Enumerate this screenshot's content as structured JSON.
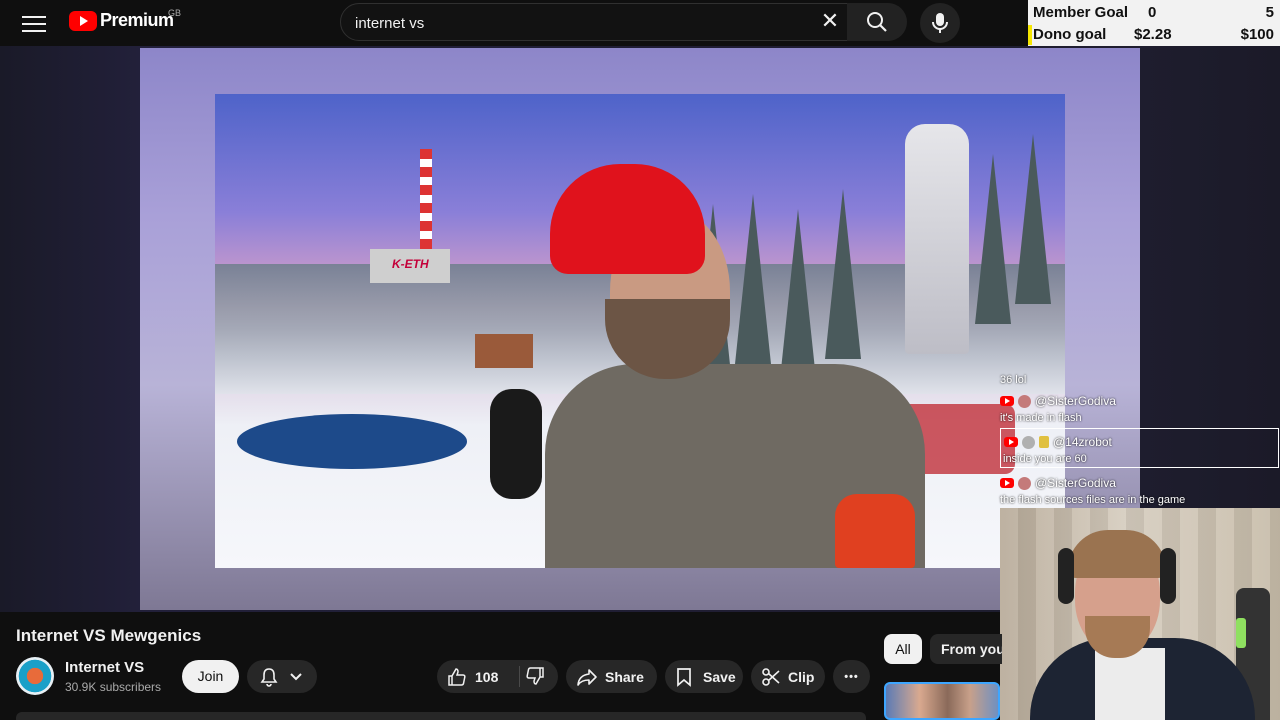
{
  "masthead": {
    "logo_text": "Premium",
    "region": "GB",
    "search": {
      "value": "internet vs",
      "placeholder": "Search"
    },
    "clear_symbol": "✕"
  },
  "goals": {
    "member": {
      "label": "Member Goal",
      "current": "0",
      "target": "5"
    },
    "dono": {
      "label": "Dono goal",
      "current": "$2.28",
      "target": "$100"
    },
    "accent": "#f5e600"
  },
  "video": {
    "sign_text": "K-ETH"
  },
  "chat": {
    "messages": [
      {
        "text": "36 lol"
      },
      {
        "user": "@SisterGodiva",
        "text": "it's made in flash"
      },
      {
        "user": "@14zrobot",
        "text": "inside you are 60"
      },
      {
        "user": "@SisterGodiva",
        "text": "the flash sources files are in the game"
      }
    ]
  },
  "below": {
    "title": "Internet VS Mewgenics",
    "channel": {
      "name": "Internet VS",
      "subscribers": "30.9K subscribers"
    },
    "join_label": "Join",
    "likes": "108",
    "share_label": "Share",
    "save_label": "Save",
    "clip_label": "Clip",
    "more_symbol": "•••"
  },
  "chips": {
    "all": "All",
    "from": "From your"
  },
  "colors": {
    "youtube_red": "#ff0000",
    "background": "#0f0f0f",
    "pill": "#272727"
  }
}
